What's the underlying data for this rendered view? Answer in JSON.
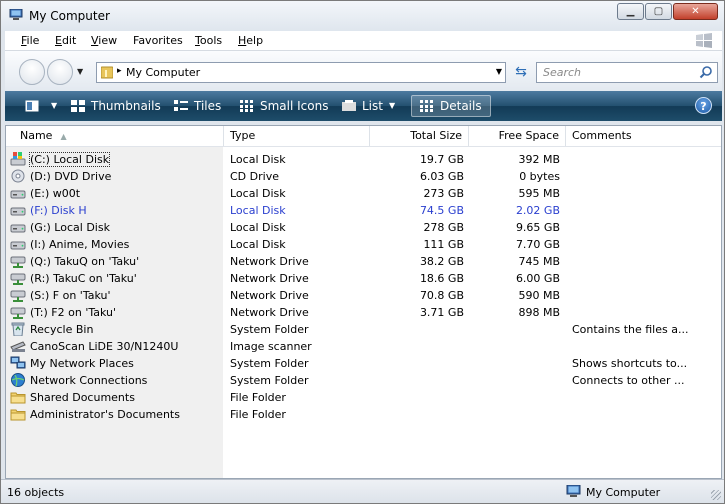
{
  "window": {
    "title": "My Computer"
  },
  "menu": [
    {
      "label": "File",
      "u": "F",
      "rest": "ile"
    },
    {
      "label": "Edit",
      "u": "E",
      "rest": "dit"
    },
    {
      "label": "View",
      "u": "V",
      "rest": "iew"
    },
    {
      "label": "Favorites",
      "u": "",
      "rest": "Favorites"
    },
    {
      "label": "Tools",
      "u": "T",
      "rest": "ools"
    },
    {
      "label": "Help",
      "u": "H",
      "rest": "elp"
    }
  ],
  "address": {
    "text": "My Computer",
    "separator": "▸"
  },
  "search": {
    "placeholder": "Search"
  },
  "toolbar": {
    "thumbnails": "Thumbnails",
    "tiles": "Tiles",
    "small_icons": "Small Icons",
    "list": "List",
    "details": "Details",
    "help": "?"
  },
  "columns": {
    "name": "Name",
    "type": "Type",
    "total": "Total Size",
    "free": "Free Space",
    "comments": "Comments"
  },
  "rows": [
    {
      "name": "(C:) Local Disk",
      "type": "Local Disk",
      "total": "19.7 GB",
      "free": "392 MB",
      "comments": "",
      "icon": "system-drive-icon"
    },
    {
      "name": "(D:) DVD Drive",
      "type": "CD Drive",
      "total": "6.03 GB",
      "free": "0 bytes",
      "comments": "",
      "icon": "dvd-drive-icon"
    },
    {
      "name": "(E:) w00t",
      "type": "Local Disk",
      "total": "273 GB",
      "free": "595 MB",
      "comments": "",
      "icon": "hard-drive-icon"
    },
    {
      "name": "(F:) Disk H",
      "type": "Local Disk",
      "total": "74.5 GB",
      "free": "2.02 GB",
      "comments": "",
      "icon": "hard-drive-icon"
    },
    {
      "name": "(G:) Local Disk",
      "type": "Local Disk",
      "total": "278 GB",
      "free": "9.65 GB",
      "comments": "",
      "icon": "hard-drive-icon"
    },
    {
      "name": "(I:) Anime, Movies",
      "type": "Local Disk",
      "total": "111 GB",
      "free": "7.70 GB",
      "comments": "",
      "icon": "hard-drive-icon"
    },
    {
      "name": "(Q:) TakuQ on 'Taku'",
      "type": "Network Drive",
      "total": "38.2 GB",
      "free": "745 MB",
      "comments": "",
      "icon": "network-drive-icon"
    },
    {
      "name": "(R:) TakuC on 'Taku'",
      "type": "Network Drive",
      "total": "18.6 GB",
      "free": "6.00 GB",
      "comments": "",
      "icon": "network-drive-icon"
    },
    {
      "name": "(S:) F on 'Taku'",
      "type": "Network Drive",
      "total": "70.8 GB",
      "free": "590 MB",
      "comments": "",
      "icon": "network-drive-icon"
    },
    {
      "name": "(T:) F2 on 'Taku'",
      "type": "Network Drive",
      "total": "3.71 GB",
      "free": "898 MB",
      "comments": "",
      "icon": "network-drive-icon"
    },
    {
      "name": "Recycle Bin",
      "type": "System Folder",
      "total": "",
      "free": "",
      "comments": "Contains the files a...",
      "icon": "recycle-bin-icon"
    },
    {
      "name": "CanoScan LiDE 30/N1240U",
      "type": "Image scanner",
      "total": "",
      "free": "",
      "comments": "",
      "icon": "scanner-icon"
    },
    {
      "name": "My Network Places",
      "type": "System Folder",
      "total": "",
      "free": "",
      "comments": "Shows shortcuts to...",
      "icon": "network-places-icon"
    },
    {
      "name": "Network Connections",
      "type": "System Folder",
      "total": "",
      "free": "",
      "comments": "Connects to other ...",
      "icon": "network-connections-icon"
    },
    {
      "name": "Shared Documents",
      "type": "File Folder",
      "total": "",
      "free": "",
      "comments": "",
      "icon": "folder-icon"
    },
    {
      "name": "Administrator's Documents",
      "type": "File Folder",
      "total": "",
      "free": "",
      "comments": "",
      "icon": "folder-icon"
    }
  ],
  "highlight_color": "#2a3fcf",
  "status": {
    "count": "16 objects",
    "location": "My Computer"
  }
}
